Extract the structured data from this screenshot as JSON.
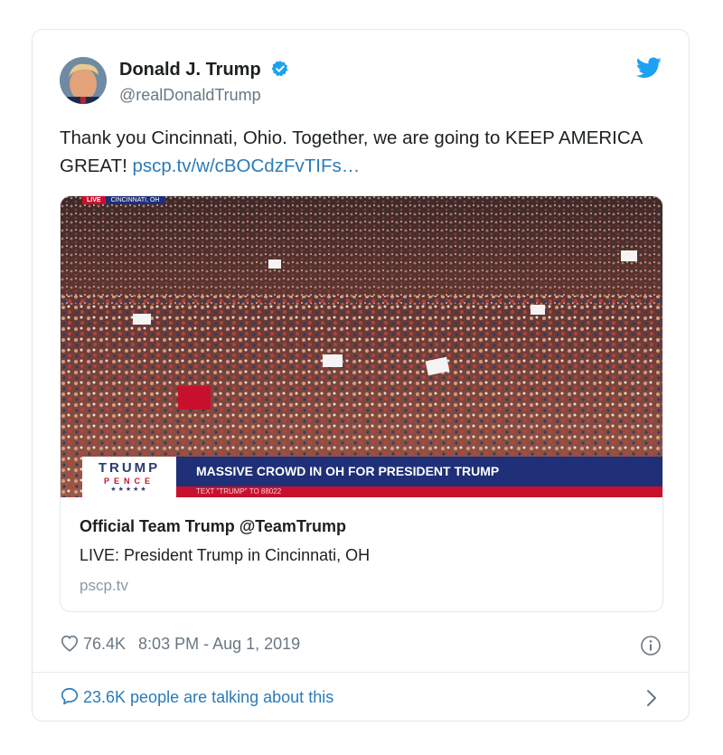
{
  "tweet": {
    "author_name": "Donald J. Trump",
    "handle": "@realDonaldTrump",
    "text": "Thank you Cincinnati, Ohio. Together, we are going to KEEP AMERICA GREAT!",
    "link": "pscp.tv/w/cBOCdzFvTIFs…"
  },
  "media": {
    "live_tag": "LIVE",
    "location_tag": "CINCINNATI, OH",
    "logo_top": "TRUMP",
    "logo_bottom": "PENCE",
    "logo_stars": "★★★★★",
    "banner": "MASSIVE CROWD IN OH FOR PRESIDENT TRUMP",
    "ticker": "TEXT \"TRUMP\" TO 88022"
  },
  "card": {
    "title": "Official Team Trump @TeamTrump",
    "description": "LIVE: President Trump in Cincinnati, OH",
    "domain": "pscp.tv"
  },
  "meta": {
    "likes": "76.4K",
    "timestamp": "8:03 PM - Aug 1, 2019"
  },
  "footer": {
    "talking": "23.6K people are talking about this"
  },
  "icons": {
    "verified": "verified-badge-icon",
    "brand": "twitter-bird-icon",
    "like": "heart-icon",
    "info": "info-icon",
    "reply": "speech-bubble-icon",
    "more": "chevron-right-icon"
  },
  "colors": {
    "link": "#2b7bb9",
    "verified": "#1da1f2",
    "banner_blue": "#1f2f78",
    "banner_red": "#c8102e"
  }
}
